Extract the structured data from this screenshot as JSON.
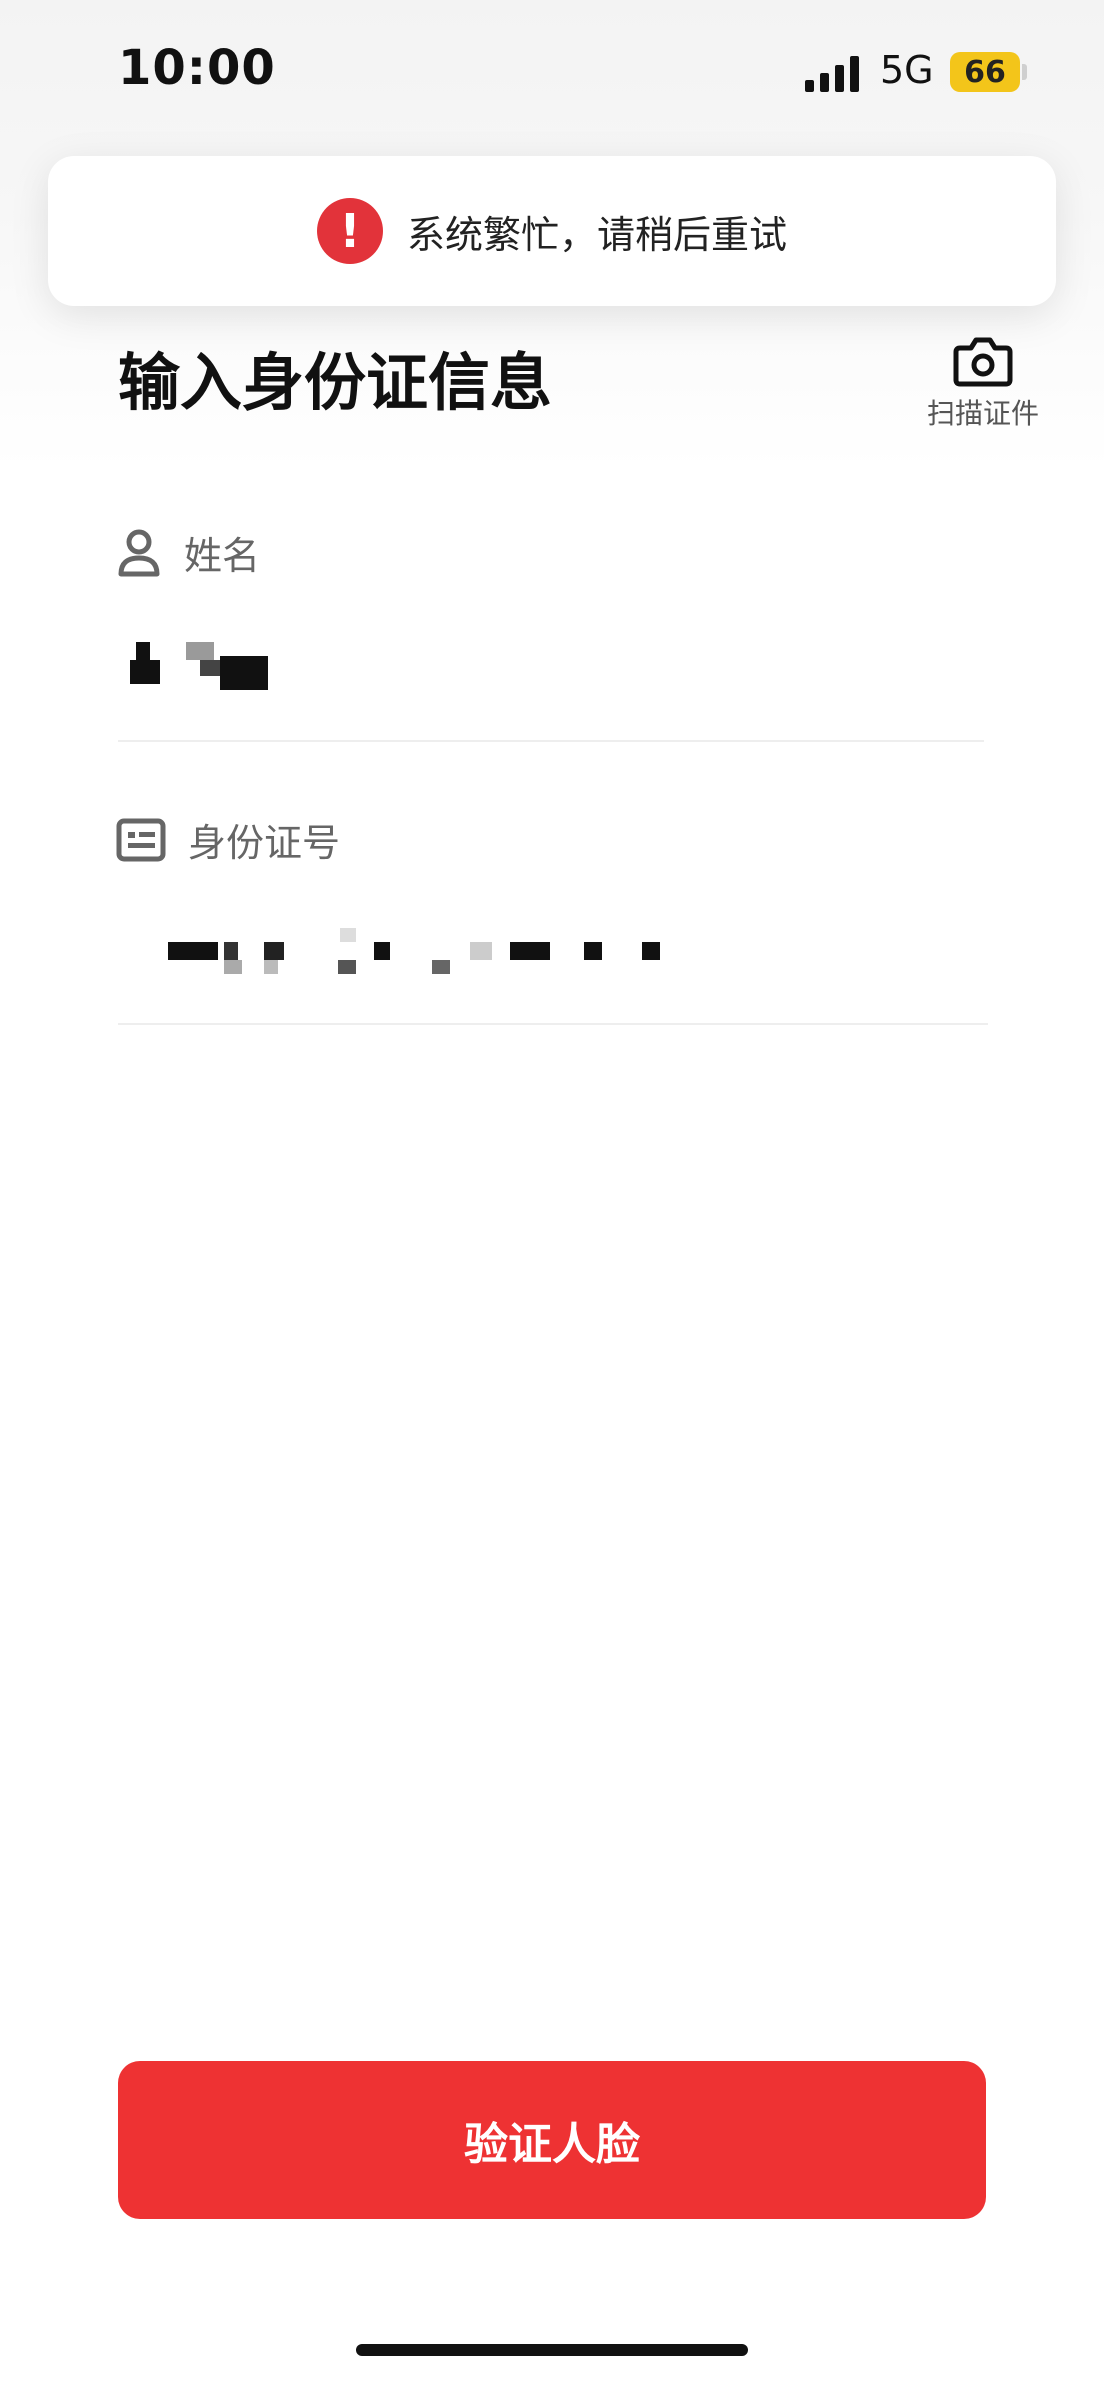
{
  "status_bar": {
    "time": "10:00",
    "network": "5G",
    "battery": "66"
  },
  "toast": {
    "message": "系统繁忙，请稍后重试",
    "icon": "alert-icon"
  },
  "header": {
    "title": "输入身份证信息",
    "scan_label": "扫描证件"
  },
  "form": {
    "name": {
      "label": "姓名",
      "value": "",
      "icon": "person-icon"
    },
    "id_number": {
      "label": "身份证号",
      "value": "",
      "icon": "id-card-icon"
    }
  },
  "actions": {
    "verify_label": "验证人脸"
  },
  "colors": {
    "accent": "#EE3233",
    "alert": "#E2333A",
    "battery": "#F3C51A"
  }
}
